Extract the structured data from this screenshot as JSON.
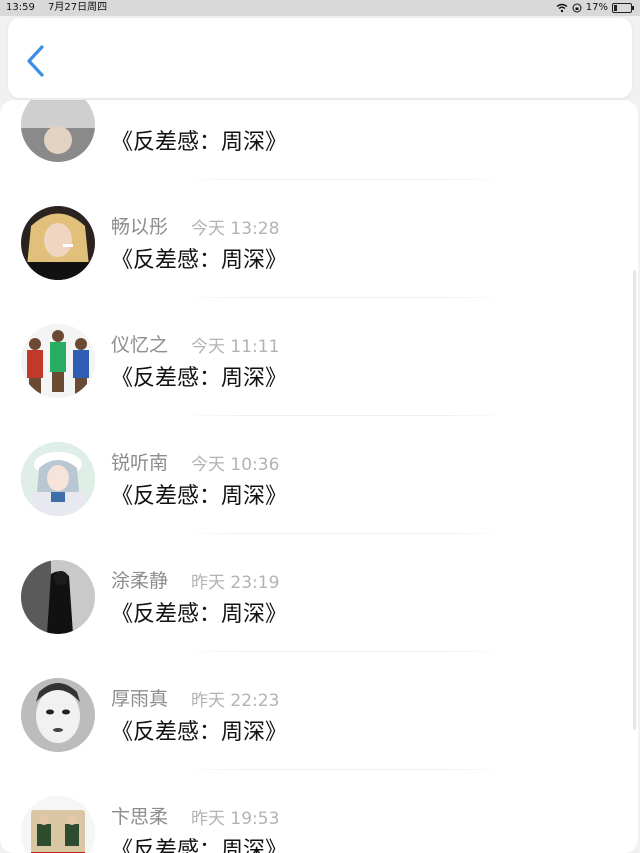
{
  "status_bar": {
    "time": "13:59",
    "date": "7月27日周四",
    "battery": "17%"
  },
  "header": {
    "back_icon": "chevron-left-icon",
    "accent_color": "#3a8ee6"
  },
  "list": {
    "items": [
      {
        "name": "",
        "time": "",
        "title": "《反差感：周深》",
        "avatar": "avatar-partial"
      },
      {
        "name": "畅以彤",
        "time": "今天 13:28",
        "title": "《反差感：周深》",
        "avatar": "avatar-woman-blonde"
      },
      {
        "name": "仪忆之",
        "time": "今天 11:11",
        "title": "《反差感：周深》",
        "avatar": "avatar-basketball-players"
      },
      {
        "name": "锐听南",
        "time": "今天 10:36",
        "title": "《反差感：周深》",
        "avatar": "avatar-anime-girl"
      },
      {
        "name": "涂柔静",
        "time": "昨天 23:19",
        "title": "《反差感：周深》",
        "avatar": "avatar-dark-figure"
      },
      {
        "name": "厚雨真",
        "time": "昨天 22:23",
        "title": "《反差感：周深》",
        "avatar": "avatar-vintage-face"
      },
      {
        "name": "卞思柔",
        "time": "昨天 19:53",
        "title": "《反差感：周深》",
        "avatar": "avatar-cake-figurines"
      }
    ]
  }
}
